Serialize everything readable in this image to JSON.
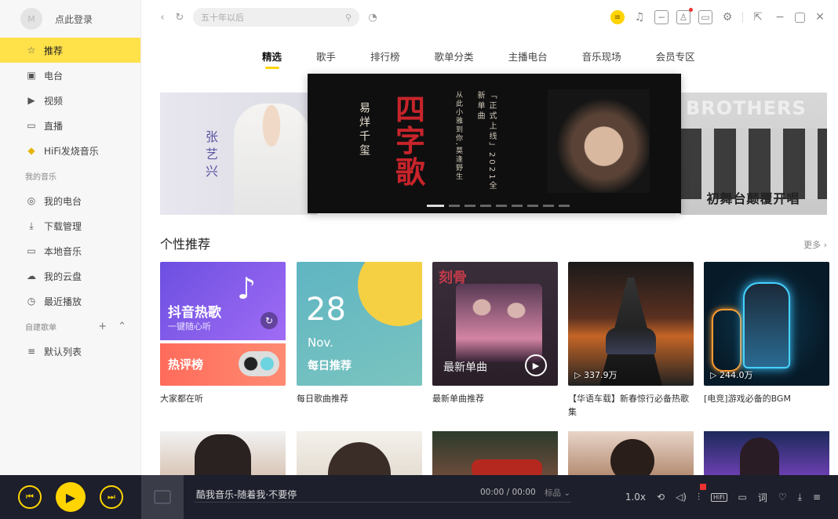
{
  "profile": {
    "avatar_text": "M",
    "login_label": "点此登录"
  },
  "sidebar": {
    "nav": [
      {
        "id": "recommend",
        "label": "推荐",
        "icon": "star-icon"
      },
      {
        "id": "radio",
        "label": "电台",
        "icon": "radio-icon"
      },
      {
        "id": "video",
        "label": "视频",
        "icon": "video-icon"
      },
      {
        "id": "live",
        "label": "直播",
        "icon": "live-icon"
      },
      {
        "id": "hifi",
        "label": "HiFi发烧音乐",
        "icon": "hifi-icon"
      }
    ],
    "my_music_label": "我的音乐",
    "my_music": [
      {
        "id": "my-radio",
        "label": "我的电台"
      },
      {
        "id": "downloads",
        "label": "下载管理"
      },
      {
        "id": "local",
        "label": "本地音乐"
      },
      {
        "id": "cloud",
        "label": "我的云盘"
      },
      {
        "id": "recent",
        "label": "最近播放"
      }
    ],
    "created_label": "自建歌单",
    "playlists": [
      {
        "id": "default",
        "label": "默认列表"
      }
    ]
  },
  "topbar": {
    "search_placeholder": "五十年以后"
  },
  "tabs": [
    "精选",
    "歌手",
    "排行榜",
    "歌单分类",
    "主播电台",
    "音乐现场",
    "会员专区"
  ],
  "banner": {
    "left_name": "张艺兴",
    "singer": "易烊千玺",
    "title": "四字歌",
    "tag_line_1": "「正式上线」2021全新单曲",
    "tag_line_2": "从此小雅到你,莫逢野生",
    "right_brand": "BROTHERS",
    "right_caption": "初舞台颠覆开唱"
  },
  "section": {
    "title": "个性推荐",
    "more": "更多"
  },
  "cards": [
    {
      "id": "douyin",
      "line1": "抖音热歌",
      "line2": "一键随心听",
      "line3": "热评榜",
      "caption": "大家都在听"
    },
    {
      "id": "daily",
      "day": "28",
      "month": "Nov.",
      "label": "每日推荐",
      "caption": "每日歌曲推荐"
    },
    {
      "id": "newsingle",
      "corner": "刻骨",
      "label": "最新单曲",
      "caption": "最新单曲推荐"
    },
    {
      "id": "drive",
      "plays": "▷ 337.9万",
      "caption": "【华语车载】新春惊行必备热歌集"
    },
    {
      "id": "game",
      "plays": "▷ 244.0万",
      "caption": "[电竞]游戏必备的BGM"
    }
  ],
  "player": {
    "track": "酷我音乐-随着我·不要停",
    "time": "00:00 / 00:00",
    "quality": "标品",
    "speed": "1.0x"
  }
}
